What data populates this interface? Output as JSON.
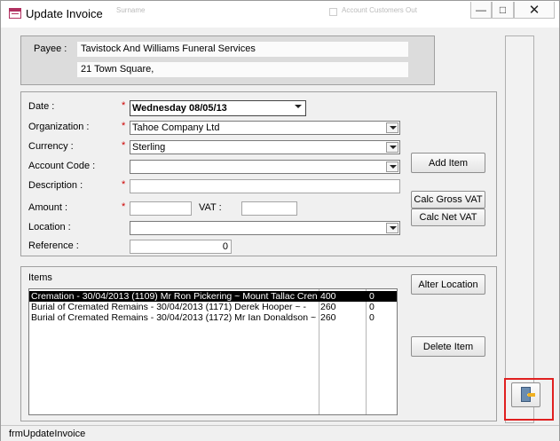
{
  "window": {
    "title": "Update Invoice",
    "background_labels": [
      "Account Customers Out",
      "Surname"
    ]
  },
  "payee": {
    "label": "Payee :",
    "name": "Tavistock And Williams Funeral Services",
    "address": "21 Town Square,"
  },
  "form": {
    "date": {
      "label": "Date :",
      "value": "Wednesday 08/05/13"
    },
    "organization": {
      "label": "Organization :",
      "value": "Tahoe Company Ltd"
    },
    "currency": {
      "label": "Currency :",
      "value": "Sterling"
    },
    "account_code": {
      "label": "Account Code :",
      "value": ""
    },
    "description": {
      "label": "Description :",
      "value": ""
    },
    "amount": {
      "label": "Amount :",
      "value": ""
    },
    "vat": {
      "label": "VAT :",
      "value": ""
    },
    "location": {
      "label": "Location :",
      "value": ""
    },
    "reference": {
      "label": "Reference :",
      "value": "0"
    },
    "required_mark": "*"
  },
  "buttons": {
    "add_item": "Add Item",
    "calc_gross_vat": "Calc Gross VAT",
    "calc_net_vat": "Calc Net VAT",
    "alter_location": "Alter Location",
    "delete_item": "Delete Item"
  },
  "items": {
    "label": "Items",
    "rows": [
      {
        "description": "Cremation -  30/04/2013 (1109) Mr Ron Pickering ~ Mount Tallac Cren",
        "amount": "400",
        "vat": "0",
        "selected": true
      },
      {
        "description": "Burial of Cremated Remains -  30/04/2013 (1171)  Derek Hooper ~  -",
        "amount": "260",
        "vat": "0",
        "selected": false
      },
      {
        "description": "Burial of Cremated Remains -  30/04/2013 (1172) Mr Ian Donaldson ~",
        "amount": "260",
        "vat": "0",
        "selected": false
      }
    ]
  },
  "status": {
    "form_name": "frmUpdateInvoice"
  },
  "icons": {
    "app": "access-form-icon",
    "exit": "exit-door-icon"
  },
  "colors": {
    "required": "#cc0000",
    "highlight": "#e02020",
    "selection": "#000000"
  }
}
